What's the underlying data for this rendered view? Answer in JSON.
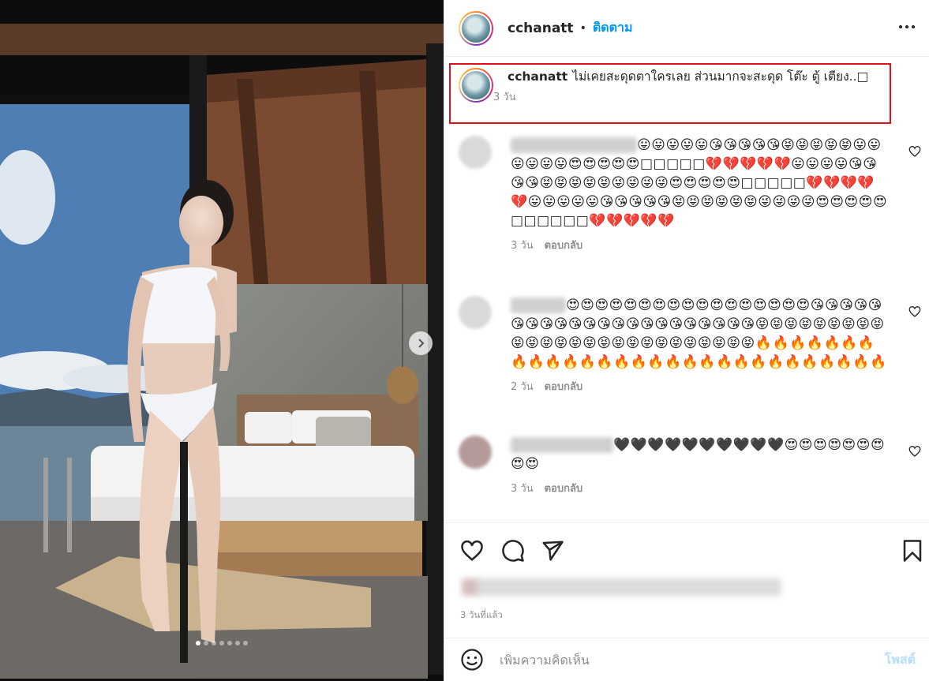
{
  "post": {
    "username": "cchanatt",
    "separator": "•",
    "follow_label": "ติดตาม",
    "more_icon": "more-horizontal-icon"
  },
  "media": {
    "next_icon": "chevron-right-icon",
    "carousel_count": 7,
    "carousel_active": 0
  },
  "caption": {
    "username": "cchanatt",
    "text": "ไม่เคยสะดุดตาใครเลย ส่วนมากจะสะดุด โต๊ะ ตู้ เตียง..□",
    "time": "3 วัน",
    "highlight_color": "#e0131b"
  },
  "comments": [
    {
      "text": "😛😛😛😛😛😘😘😘😘😘😝😝😝😝😝😛😛😛😛😛😛😍😍😍😍😍□□□□□💔💔💔💔💔😛😛😛😛😘😘😘😘😝😝😝😝😝😜😜😜😜😍😍😍😍😍□□□□□💔💔💔💔💔😛😛😛😛😛😘😘😘😘😘😝😝😝😝😝😝😜😜😜😜😍😍😍😍😍□□□□□□💔💔💔💔💔",
      "time": "3 วัน",
      "reply": "ตอบกลับ"
    },
    {
      "text": "😍😍😍😍😍😍😍😍😍😍😍😍😍😍😍😍😍😘😘😘😘😘😘😘😘😘😘😘😘😘😘😘😘😘😘😘😘😘😘😝😝😝😝😝😝😝😝😝😝😝😝😝😝😝😝😝😝😝😝😝😝😝😝😝😝🔥🔥🔥🔥🔥🔥🔥🔥🔥🔥🔥🔥🔥🔥🔥🔥🔥🔥🔥🔥🔥🔥🔥🔥🔥🔥🔥🔥🔥",
      "time": "2 วัน",
      "reply": "ตอบกลับ"
    },
    {
      "text": "🖤🖤🖤🖤🖤🖤🖤🖤🖤🖤😍😍😍😍😍😍😍😍😍",
      "time": "3 วัน",
      "reply": "ตอบกลับ"
    }
  ],
  "actions": {
    "like_icon": "heart-icon",
    "comment_icon": "comment-icon",
    "share_icon": "send-icon",
    "save_icon": "bookmark-icon",
    "posted_time": "3 วันที่แล้ว"
  },
  "add_comment": {
    "emoji_icon": "emoji-icon",
    "placeholder": "เพิ่มความคิดเห็น",
    "post_label": "โพสต์"
  }
}
